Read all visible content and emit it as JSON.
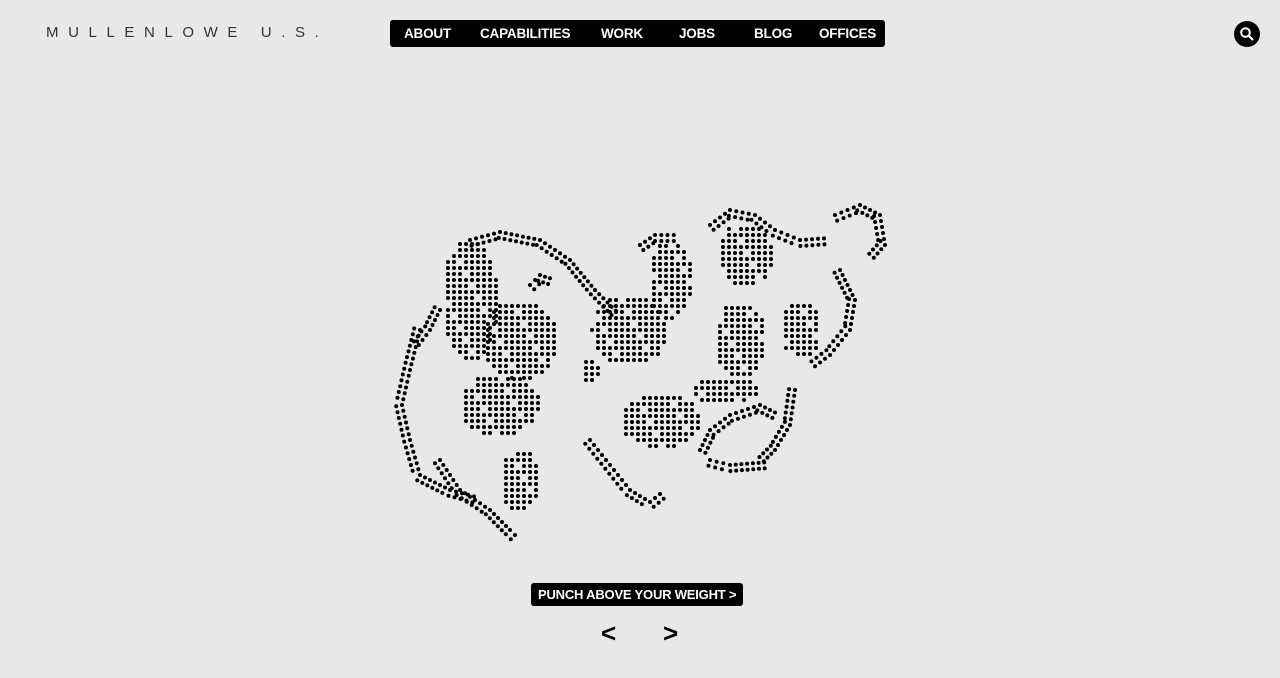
{
  "brand": {
    "logo_text": "MULLENLOWE U.S."
  },
  "nav": {
    "items": [
      {
        "label": "ABOUT"
      },
      {
        "label": "CAPABILITIES"
      },
      {
        "label": "WORK"
      },
      {
        "label": "JOBS"
      },
      {
        "label": "BLOG"
      },
      {
        "label": "OFFICES"
      }
    ]
  },
  "search": {
    "icon": "search-icon"
  },
  "hero": {
    "illustration": "dotted-octopus-illustration",
    "cta_label": "PUNCH ABOVE YOUR WEIGHT >"
  },
  "carousel": {
    "prev_label": "<",
    "next_label": ">"
  },
  "colors": {
    "background": "#e8e8e8",
    "accent": "#000000",
    "text_on_accent": "#ffffff",
    "logo": "#333333"
  }
}
